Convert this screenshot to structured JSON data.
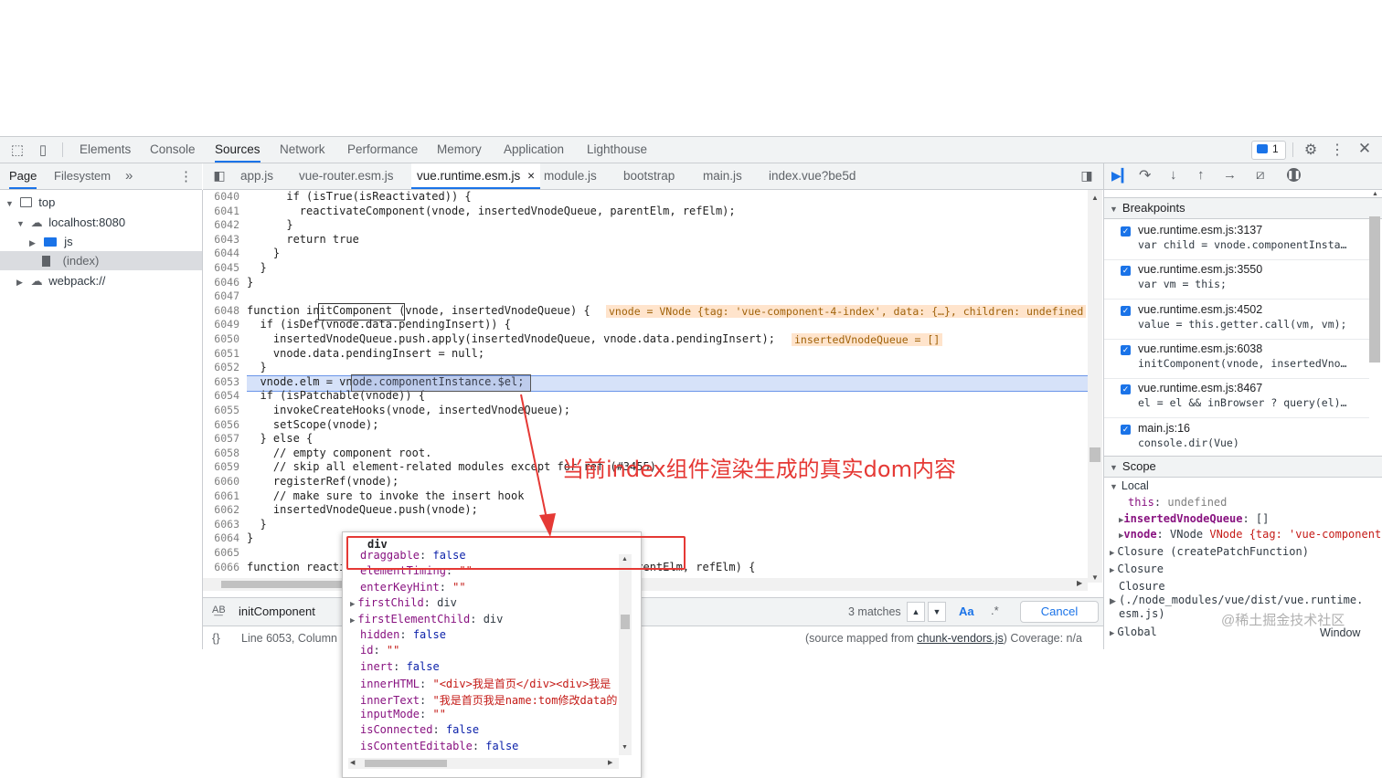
{
  "main_tabs": [
    "Elements",
    "Console",
    "Sources",
    "Network",
    "Performance",
    "Memory",
    "Application",
    "Lighthouse"
  ],
  "issues_count": "1",
  "navigator": {
    "tabs": [
      "Page",
      "Filesystem"
    ],
    "more": "»",
    "tree": {
      "top": "top",
      "host": "localhost:8080",
      "js": "js",
      "index": "(index)",
      "webpack": "webpack://"
    }
  },
  "editor_tabs": [
    "app.js",
    "vue-router.esm.js",
    "vue.runtime.esm.js",
    "module.js",
    "bootstrap",
    "main.js",
    "index.vue?be5d"
  ],
  "close_symbol": "×",
  "code_lines": [
    {
      "n": "6040",
      "t": "      if (isTrue(isReactivated)) {"
    },
    {
      "n": "6041",
      "t": "        reactivateComponent(vnode, insertedVnodeQueue, parentElm, refElm);"
    },
    {
      "n": "6042",
      "t": "      }"
    },
    {
      "n": "6043",
      "t": "      return true"
    },
    {
      "n": "6044",
      "t": "    }"
    },
    {
      "n": "6045",
      "t": "  }"
    },
    {
      "n": "6046",
      "t": "}"
    },
    {
      "n": "6047",
      "t": ""
    },
    {
      "n": "6048",
      "t": "function initComponent (vnode, insertedVnodeQueue) {"
    },
    {
      "n": "6049",
      "t": "  if (isDef(vnode.data.pendingInsert)) {"
    },
    {
      "n": "6050",
      "t": "    insertedVnodeQueue.push.apply(insertedVnodeQueue, vnode.data.pendingInsert);"
    },
    {
      "n": "6051",
      "t": "    vnode.data.pendingInsert = null;"
    },
    {
      "n": "6052",
      "t": "  }"
    },
    {
      "n": "6053",
      "t": "  vnode.elm = vnode.componentInstance.$el;"
    },
    {
      "n": "6054",
      "t": "  if (isPatchable(vnode)) {"
    },
    {
      "n": "6055",
      "t": "    invokeCreateHooks(vnode, insertedVnodeQueue);"
    },
    {
      "n": "6056",
      "t": "    setScope(vnode);"
    },
    {
      "n": "6057",
      "t": "  } else {"
    },
    {
      "n": "6058",
      "t": "    // empty component root."
    },
    {
      "n": "6059",
      "t": "    // skip all element-related modules except for ref (#3455)"
    },
    {
      "n": "6060",
      "t": "    registerRef(vnode);"
    },
    {
      "n": "6061",
      "t": "    // make sure to invoke the insert hook"
    },
    {
      "n": "6062",
      "t": "    insertedVnodeQueue.push(vnode);"
    },
    {
      "n": "6063",
      "t": "  }"
    },
    {
      "n": "6064",
      "t": "}"
    },
    {
      "n": "6065",
      "t": ""
    },
    {
      "n": "6066",
      "t": "function reactivateComponent (vnode, insertedVnodeQueue, parentElm, refElm) {"
    }
  ],
  "inline_values": {
    "line6048": "vnode = VNode {tag: 'vue-component-4-index', data: {…}, children: undefined",
    "line6050": "insertedVnodeQueue = []"
  },
  "popover": {
    "title": "div",
    "rows": [
      {
        "k": "draggable",
        "v": "false",
        "type": "k"
      },
      {
        "k": "elementTiming",
        "v": "\"\"",
        "type": "s"
      },
      {
        "k": "enterKeyHint",
        "v": "\"\"",
        "type": "s"
      },
      {
        "k": "firstChild",
        "v": "div",
        "type": "d",
        "expand": true
      },
      {
        "k": "firstElementChild",
        "v": "div",
        "type": "d",
        "expand": true
      },
      {
        "k": "hidden",
        "v": "false",
        "type": "k"
      },
      {
        "k": "id",
        "v": "\"\"",
        "type": "s"
      },
      {
        "k": "inert",
        "v": "false",
        "type": "k"
      },
      {
        "k": "innerHTML",
        "v": "\"<div>我是首页</div><div>我是",
        "type": "s"
      },
      {
        "k": "innerText",
        "v": "\"我是首页我是name:tom修改data的",
        "type": "s"
      },
      {
        "k": "inputMode",
        "v": "\"\"",
        "type": "s"
      },
      {
        "k": "isConnected",
        "v": "false",
        "type": "k"
      },
      {
        "k": "isContentEditable",
        "v": "false",
        "type": "k"
      }
    ]
  },
  "annotation": "当前index组件渲染生成的真实dom内容",
  "search": {
    "query": "initComponent",
    "matches": "3 matches",
    "case_label": "Aa",
    "regex_label": ".*",
    "cancel": "Cancel"
  },
  "status": {
    "position": "Line 6053, Column",
    "source_mapped": "(source mapped from ",
    "source_file": "chunk-vendors.js",
    "coverage": ") Coverage: n/a"
  },
  "sidebar": {
    "breakpoints_title": "Breakpoints",
    "breakpoints": [
      {
        "name": "vue.runtime.esm.js:3137",
        "code": "var child = vnode.componentInsta…"
      },
      {
        "name": "vue.runtime.esm.js:3550",
        "code": "var vm = this;"
      },
      {
        "name": "vue.runtime.esm.js:4502",
        "code": "value = this.getter.call(vm, vm);"
      },
      {
        "name": "vue.runtime.esm.js:6038",
        "code": "initComponent(vnode, insertedVno…"
      },
      {
        "name": "vue.runtime.esm.js:8467",
        "code": "el = el && inBrowser ? query(el)…"
      },
      {
        "name": "main.js:16",
        "code": "console.dir(Vue)"
      }
    ],
    "scope_title": "Scope",
    "scope": {
      "local": "Local",
      "this_k": "this",
      "this_v": "undefined",
      "ivq_k": "insertedVnodeQueue",
      "ivq_v": "[]",
      "vnode_k": "vnode",
      "vnode_v": "VNode {tag: 'vue-component-4-i",
      "closure1": "Closure (createPatchFunction)",
      "closure2": "Closure",
      "closure3a": "Closure",
      "closure3b": "(./node_modules/vue/dist/vue.runtime.",
      "closure3c": "esm.js)",
      "global": "Global",
      "window": "Window"
    }
  },
  "watermark": "@稀土掘金技术社区",
  "colors": {
    "accent": "#1a73e8",
    "annotation": "#e53935",
    "exec_line": "#d6e2f9"
  }
}
